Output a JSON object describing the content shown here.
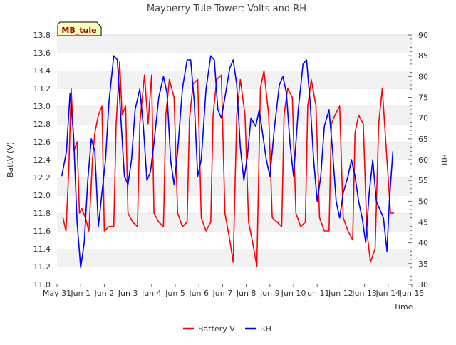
{
  "chart_data": {
    "type": "line",
    "title": "Mayberry Tule Tower: Volts and RH",
    "xlabel": "Time",
    "ylabel_left": "BattV (V)",
    "ylabel_right": "RH",
    "station_tag": "MB_tule",
    "x_tick_labels": [
      "May 31",
      "Jun 1",
      "Jun 2",
      "Jun 3",
      "Jun 4",
      "Jun 5",
      "Jun 6",
      "Jun 7",
      "Jun 8",
      "Jun 9",
      "Jun 10",
      "Jun 11",
      "Jun 12",
      "Jun 13",
      "Jun 14",
      "Jun 15"
    ],
    "xlim_days": [
      0,
      15
    ],
    "ylim_left": [
      11.0,
      13.8
    ],
    "ylim_right": [
      30,
      90
    ],
    "y_ticks_left": [
      "11.0",
      "11.2",
      "11.4",
      "11.6",
      "11.8",
      "12.0",
      "12.2",
      "12.4",
      "12.6",
      "12.8",
      "13.0",
      "13.2",
      "13.4",
      "13.6",
      "13.8"
    ],
    "y_ticks_right": [
      "30",
      "35",
      "40",
      "45",
      "50",
      "55",
      "60",
      "65",
      "70",
      "75",
      "80",
      "85",
      "90"
    ],
    "grid": "horizontal alternating bands",
    "legend_position": "bottom-center",
    "series": [
      {
        "name": "Battery V",
        "axis": "left",
        "color": "#ff0000",
        "points": [
          [
            0.25,
            11.75
          ],
          [
            0.38,
            11.6
          ],
          [
            0.5,
            12.3
          ],
          [
            0.6,
            13.2
          ],
          [
            0.72,
            12.5
          ],
          [
            0.85,
            12.6
          ],
          [
            0.95,
            11.8
          ],
          [
            1.05,
            11.85
          ],
          [
            1.2,
            11.75
          ],
          [
            1.35,
            11.6
          ],
          [
            1.5,
            12.4
          ],
          [
            1.6,
            12.7
          ],
          [
            1.75,
            12.9
          ],
          [
            1.9,
            13.0
          ],
          [
            2.0,
            11.6
          ],
          [
            2.2,
            11.65
          ],
          [
            2.4,
            11.65
          ],
          [
            2.5,
            12.8
          ],
          [
            2.65,
            13.5
          ],
          [
            2.75,
            12.9
          ],
          [
            2.9,
            13.0
          ],
          [
            3.0,
            11.8
          ],
          [
            3.2,
            11.7
          ],
          [
            3.4,
            11.65
          ],
          [
            3.5,
            12.8
          ],
          [
            3.7,
            13.35
          ],
          [
            3.85,
            12.8
          ],
          [
            4.0,
            13.35
          ],
          [
            4.1,
            11.8
          ],
          [
            4.3,
            11.7
          ],
          [
            4.5,
            11.65
          ],
          [
            4.6,
            12.9
          ],
          [
            4.75,
            13.3
          ],
          [
            4.95,
            13.1
          ],
          [
            5.1,
            11.8
          ],
          [
            5.3,
            11.65
          ],
          [
            5.5,
            11.7
          ],
          [
            5.6,
            12.85
          ],
          [
            5.75,
            13.25
          ],
          [
            5.95,
            13.3
          ],
          [
            6.1,
            11.75
          ],
          [
            6.3,
            11.6
          ],
          [
            6.5,
            11.7
          ],
          [
            6.6,
            12.9
          ],
          [
            6.75,
            13.3
          ],
          [
            6.95,
            13.35
          ],
          [
            7.1,
            11.8
          ],
          [
            7.3,
            11.5
          ],
          [
            7.45,
            11.25
          ],
          [
            7.6,
            12.9
          ],
          [
            7.75,
            13.3
          ],
          [
            7.95,
            12.9
          ],
          [
            8.1,
            11.7
          ],
          [
            8.25,
            11.5
          ],
          [
            8.45,
            11.2
          ],
          [
            8.6,
            13.2
          ],
          [
            8.75,
            13.4
          ],
          [
            8.95,
            12.9
          ],
          [
            9.1,
            11.75
          ],
          [
            9.3,
            11.7
          ],
          [
            9.5,
            11.65
          ],
          [
            9.6,
            12.9
          ],
          [
            9.75,
            13.2
          ],
          [
            9.95,
            13.1
          ],
          [
            10.1,
            11.8
          ],
          [
            10.3,
            11.65
          ],
          [
            10.5,
            11.7
          ],
          [
            10.6,
            13.0
          ],
          [
            10.75,
            13.3
          ],
          [
            10.95,
            13.0
          ],
          [
            11.1,
            11.75
          ],
          [
            11.3,
            11.6
          ],
          [
            11.5,
            11.6
          ],
          [
            11.6,
            12.8
          ],
          [
            11.75,
            12.9
          ],
          [
            11.95,
            13.0
          ],
          [
            12.1,
            11.75
          ],
          [
            12.3,
            11.6
          ],
          [
            12.5,
            11.5
          ],
          [
            12.6,
            12.7
          ],
          [
            12.75,
            12.9
          ],
          [
            12.95,
            12.8
          ],
          [
            13.1,
            11.6
          ],
          [
            13.25,
            11.25
          ],
          [
            13.45,
            11.4
          ],
          [
            13.6,
            12.8
          ],
          [
            13.75,
            13.2
          ],
          [
            13.95,
            12.4
          ],
          [
            14.1,
            11.8
          ],
          [
            14.25,
            11.8
          ]
        ]
      },
      {
        "name": "RH",
        "axis": "right",
        "color": "#0000ff",
        "points": [
          [
            0.2,
            56
          ],
          [
            0.4,
            62
          ],
          [
            0.55,
            76
          ],
          [
            0.7,
            66
          ],
          [
            0.85,
            45
          ],
          [
            1.0,
            34
          ],
          [
            1.15,
            40
          ],
          [
            1.3,
            55
          ],
          [
            1.45,
            65
          ],
          [
            1.6,
            62
          ],
          [
            1.75,
            44
          ],
          [
            1.9,
            52
          ],
          [
            2.05,
            60
          ],
          [
            2.2,
            74
          ],
          [
            2.4,
            85
          ],
          [
            2.55,
            84
          ],
          [
            2.7,
            70
          ],
          [
            2.85,
            56
          ],
          [
            3.0,
            54
          ],
          [
            3.15,
            60
          ],
          [
            3.3,
            72
          ],
          [
            3.5,
            77
          ],
          [
            3.65,
            68
          ],
          [
            3.8,
            55
          ],
          [
            3.95,
            57
          ],
          [
            4.1,
            64
          ],
          [
            4.3,
            75
          ],
          [
            4.5,
            80
          ],
          [
            4.65,
            76
          ],
          [
            4.8,
            60
          ],
          [
            4.95,
            54
          ],
          [
            5.1,
            62
          ],
          [
            5.3,
            77
          ],
          [
            5.5,
            84
          ],
          [
            5.65,
            84
          ],
          [
            5.8,
            74
          ],
          [
            5.95,
            56
          ],
          [
            6.1,
            60
          ],
          [
            6.3,
            77
          ],
          [
            6.5,
            85
          ],
          [
            6.65,
            84
          ],
          [
            6.8,
            72
          ],
          [
            6.95,
            70
          ],
          [
            7.1,
            75
          ],
          [
            7.3,
            82
          ],
          [
            7.45,
            84
          ],
          [
            7.6,
            78
          ],
          [
            7.75,
            63
          ],
          [
            7.9,
            55
          ],
          [
            8.05,
            61
          ],
          [
            8.2,
            70
          ],
          [
            8.4,
            68
          ],
          [
            8.55,
            72
          ],
          [
            8.7,
            66
          ],
          [
            8.85,
            60
          ],
          [
            9.0,
            56
          ],
          [
            9.2,
            68
          ],
          [
            9.4,
            78
          ],
          [
            9.55,
            80
          ],
          [
            9.7,
            76
          ],
          [
            9.85,
            64
          ],
          [
            10.0,
            56
          ],
          [
            10.2,
            72
          ],
          [
            10.4,
            83
          ],
          [
            10.55,
            84
          ],
          [
            10.7,
            74
          ],
          [
            10.85,
            60
          ],
          [
            11.0,
            50
          ],
          [
            11.15,
            56
          ],
          [
            11.3,
            68
          ],
          [
            11.5,
            72
          ],
          [
            11.65,
            62
          ],
          [
            11.8,
            50
          ],
          [
            11.95,
            46
          ],
          [
            12.1,
            52
          ],
          [
            12.3,
            56
          ],
          [
            12.45,
            60
          ],
          [
            12.6,
            56
          ],
          [
            12.75,
            50
          ],
          [
            12.9,
            46
          ],
          [
            13.05,
            40
          ],
          [
            13.2,
            52
          ],
          [
            13.35,
            60
          ],
          [
            13.5,
            50
          ],
          [
            13.65,
            48
          ],
          [
            13.8,
            46
          ],
          [
            13.95,
            38
          ],
          [
            14.05,
            50
          ],
          [
            14.2,
            62
          ]
        ]
      }
    ]
  }
}
